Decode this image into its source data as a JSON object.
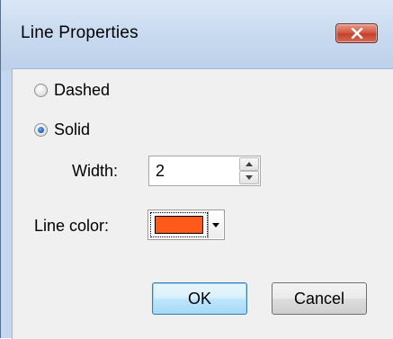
{
  "window": {
    "title": "Line Properties"
  },
  "style_options": [
    {
      "label": "Dashed",
      "checked": false
    },
    {
      "label": "Solid",
      "checked": true
    }
  ],
  "width_field": {
    "label": "Width:",
    "value": "2"
  },
  "line_color": {
    "label": "Line color:",
    "color": "#ff5a1a"
  },
  "buttons": {
    "ok": "OK",
    "cancel": "Cancel"
  },
  "colors": {
    "title_bar": "#c7d9ef",
    "close_button": "#c94a35",
    "dialog_body": "#f0f0f0"
  }
}
